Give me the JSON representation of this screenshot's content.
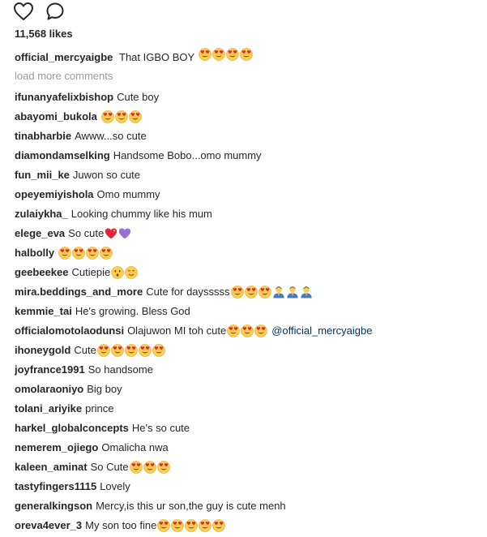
{
  "post": {
    "likes": "11,568 likes",
    "caption": {
      "user": "official_mercyaigbe",
      "text": "That IGBO BOY",
      "emojis": [
        "heart-eyes",
        "heart-eyes",
        "heart-eyes",
        "heart-eyes"
      ]
    },
    "load_more": "load more comments"
  },
  "comments": [
    {
      "user": "ifunanyafelixbishop",
      "text": "Cute boy",
      "emojis": []
    },
    {
      "user": "abayomi_bukola",
      "text": "",
      "emojis": [
        "heart-eyes",
        "heart-eyes",
        "heart-eyes"
      ]
    },
    {
      "user": "tinabharbie",
      "text": "Awww...so cute",
      "emojis": []
    },
    {
      "user": "diamondamselking",
      "text": "Handsome Bobo...omo mummy",
      "emojis": []
    },
    {
      "user": "fun_mii_ke",
      "text": "Juwon so cute",
      "emojis": []
    },
    {
      "user": "opeyemiyishola",
      "text": "Omo mummy",
      "emojis": []
    },
    {
      "user": "zulaiykha_",
      "text": "Looking chummy like his mum",
      "emojis": []
    },
    {
      "user": "elege_eva",
      "text": "So cute",
      "emojis": [
        "heart-sparkle",
        "purple-heart"
      ]
    },
    {
      "user": "halbolly",
      "text": "",
      "emojis": [
        "heart-eyes",
        "heart-eyes",
        "heart-eyes",
        "heart-eyes"
      ]
    },
    {
      "user": "geebeekee",
      "text": "Cutiepie",
      "emojis": [
        "hushed-face",
        "smirk-face"
      ]
    },
    {
      "user": "mira.beddings_and_more",
      "text": "Cute for daysssss",
      "emojis": [
        "heart-eyes",
        "heart-eyes",
        "heart-eyes",
        "praying-person",
        "praying-person",
        "praying-person"
      ]
    },
    {
      "user": "kemmie_tai",
      "text": "He's growing. Bless God",
      "emojis": []
    },
    {
      "user": "officialomotolaodunsi",
      "text": "Olajuwon MI toh cute",
      "emojis": [
        "heart-eyes",
        "heart-eyes",
        "heart-eyes"
      ],
      "mention": "@official_mercyaigbe"
    },
    {
      "user": "ihoneygold",
      "text": "Cute",
      "emojis": [
        "heart-eyes",
        "heart-eyes",
        "heart-eyes",
        "heart-eyes",
        "heart-eyes"
      ]
    },
    {
      "user": "joyfrance1991",
      "text": "So handsome",
      "emojis": []
    },
    {
      "user": "omolaraoniyo",
      "text": "Big boy",
      "emojis": []
    },
    {
      "user": "tolani_ariyike",
      "text": "prince",
      "emojis": []
    },
    {
      "user": "harkel_globalconcepts",
      "text": "He's so cute",
      "emojis": []
    },
    {
      "user": "nemerem_ojiego",
      "text": "Omalicha nwa",
      "emojis": []
    },
    {
      "user": "kaleen_aminat",
      "text": "So Cute",
      "emojis": [
        "heart-eyes",
        "heart-eyes",
        "heart-eyes"
      ]
    },
    {
      "user": "tastyfingers1115",
      "text": "Lovely",
      "emojis": []
    },
    {
      "user": "generalkingson",
      "text": "Mercy,is this ur son,the guy is cute menh",
      "emojis": []
    },
    {
      "user": "oreva4ever_3",
      "text": "My son too fine",
      "emojis": [
        "heart-eyes",
        "heart-eyes",
        "heart-eyes",
        "heart-eyes",
        "heart-eyes"
      ]
    }
  ],
  "colors": {
    "text": "#262626",
    "muted": "#999999",
    "mention": "#003569",
    "emoji_face": "#FFCC4D",
    "emoji_heart": "#E0243A"
  }
}
